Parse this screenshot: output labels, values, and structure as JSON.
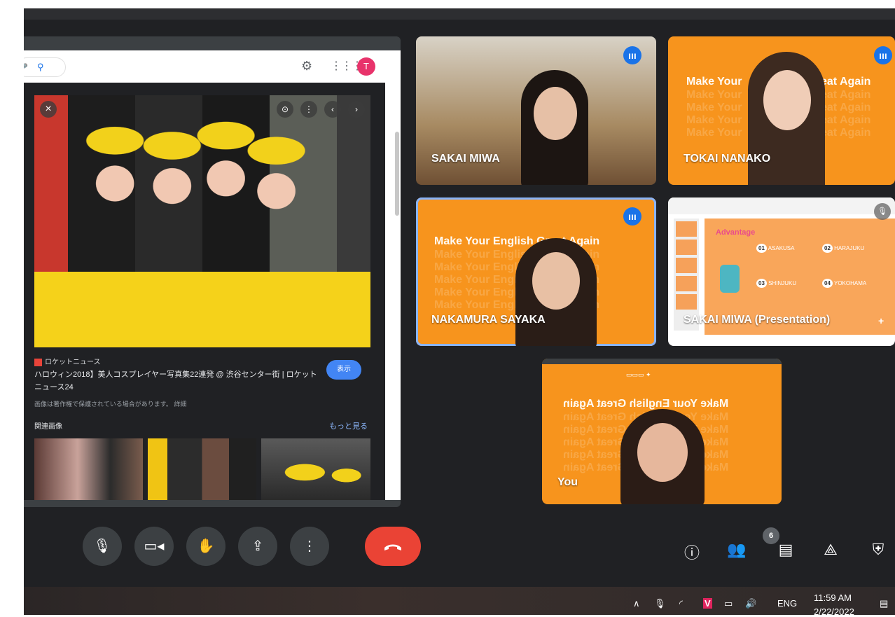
{
  "browser": {
    "avatar_letter": "T"
  },
  "result": {
    "source": "ロケットニュース",
    "title": "ハロウィン2018】美人コスプレイヤー写真集22連発 @ 渋谷センター街 | ロケットニュース24",
    "view_label": "表示",
    "copyright_note": "画像は著作権で保護されている場合があります。 詳細",
    "related_label": "関連画像",
    "more_label": "もっと見る"
  },
  "participants": [
    {
      "name": "SAKAI MIWA"
    },
    {
      "name": "TOKAI NANAKO"
    },
    {
      "name": "NAKAMURA SAYAKA"
    },
    {
      "name": "SAKAI MIWA (Presentation)"
    },
    {
      "name": "You"
    }
  ],
  "slogan": "Make Your English Great Again",
  "slogan_tokai": "Make Your",
  "slogan_tokai_right": "eat Again",
  "presentation": {
    "heading": "Advantage",
    "items": [
      {
        "num": "01",
        "label": "ASAKUSA"
      },
      {
        "num": "02",
        "label": "HARAJUKU"
      },
      {
        "num": "03",
        "label": "SHINJUKU"
      },
      {
        "num": "04",
        "label": "YOKOHAMA"
      }
    ]
  },
  "controls": {
    "participant_count": "6"
  },
  "taskbar": {
    "language": "ENG",
    "time": "11:59 AM",
    "date": "2/22/2022"
  },
  "colors": {
    "meet_bg": "#202124",
    "tile_orange": "#f7941d",
    "speaking_blue": "#1a73e8",
    "leave_red": "#ea4335"
  }
}
